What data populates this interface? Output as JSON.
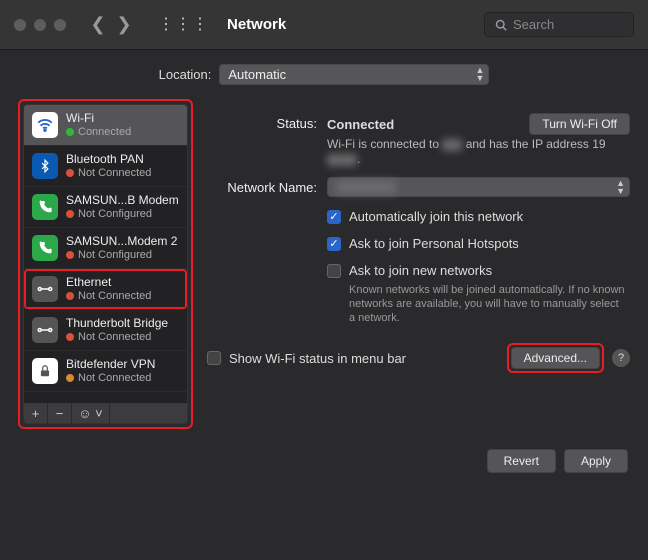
{
  "titlebar": {
    "title": "Network",
    "search_placeholder": "Search"
  },
  "location": {
    "label": "Location:",
    "value": "Automatic"
  },
  "sidebar": {
    "items": [
      {
        "name": "Wi-Fi",
        "status": "Connected",
        "status_color": "green",
        "icon": "wifi",
        "selected": true,
        "highlight": false
      },
      {
        "name": "Bluetooth PAN",
        "status": "Not Connected",
        "status_color": "red",
        "icon": "bluetooth"
      },
      {
        "name": "SAMSUN...B Modem",
        "status": "Not Configured",
        "status_color": "red",
        "icon": "modem"
      },
      {
        "name": "SAMSUN...Modem 2",
        "status": "Not Configured",
        "status_color": "red",
        "icon": "modem"
      },
      {
        "name": "Ethernet",
        "status": "Not Connected",
        "status_color": "red",
        "icon": "ethernet",
        "highlight": true
      },
      {
        "name": "Thunderbolt Bridge",
        "status": "Not Connected",
        "status_color": "red",
        "icon": "thunderbolt"
      },
      {
        "name": "Bitdefender VPN",
        "status": "Not Connected",
        "status_color": "orange",
        "icon": "vpn"
      }
    ],
    "footer": {
      "add": "+",
      "remove": "−",
      "more": "☺︎ ˅"
    }
  },
  "main": {
    "status_label": "Status:",
    "status_value": "Connected",
    "turn_off_label": "Turn Wi-Fi Off",
    "status_sub_prefix": "Wi-Fi is connected to ",
    "status_sub_mid": " and has the IP address 19",
    "network_name_label": "Network Name:",
    "network_name_value": "",
    "auto_join_label": "Automatically join this network",
    "auto_join_checked": true,
    "ask_hotspot_label": "Ask to join Personal Hotspots",
    "ask_hotspot_checked": true,
    "ask_new_label": "Ask to join new networks",
    "ask_new_checked": false,
    "ask_new_note": "Known networks will be joined automatically. If no known networks are available, you will have to manually select a network.",
    "show_menubar_label": "Show Wi-Fi status in menu bar",
    "show_menubar_checked": false,
    "advanced_label": "Advanced..."
  },
  "dialog": {
    "revert": "Revert",
    "apply": "Apply"
  }
}
